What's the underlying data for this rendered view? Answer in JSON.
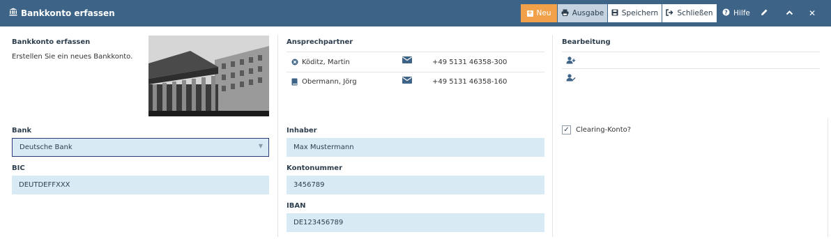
{
  "window": {
    "title": "Bankkonto erfassen",
    "title_icon": "bank-icon"
  },
  "toolbar": {
    "neu": "Neu",
    "ausgabe": "Ausgabe",
    "speichern": "Speichern",
    "schliessen": "Schließen",
    "hilfe": "Hilfe"
  },
  "intro": {
    "heading": "Bankkonto erfassen",
    "text": "Erstellen Sie ein neues Bankkonto."
  },
  "contacts": {
    "heading": "Ansprechpartner",
    "items": [
      {
        "name": "Köditz, Martin",
        "phone": "+49 5131 46358-300",
        "icon": "close-circle-icon"
      },
      {
        "name": "Obermann, Jörg",
        "phone": "+49 5131 46358-160",
        "icon": "book-icon"
      }
    ]
  },
  "editing": {
    "heading": "Bearbeitung"
  },
  "form": {
    "bank": {
      "label": "Bank",
      "value": "Deutsche Bank"
    },
    "bic": {
      "label": "BIC",
      "value": "DEUTDEFFXXX"
    },
    "inhaber": {
      "label": "Inhaber",
      "value": "Max Mustermann"
    },
    "kontonummer": {
      "label": "Kontonummer",
      "value": "3456789"
    },
    "iban": {
      "label": "IBAN",
      "value": "DE123456789"
    },
    "clearing": {
      "label": "Clearing-Konto?",
      "checked": true
    }
  },
  "colors": {
    "header": "#3d6387",
    "accent": "#f0a14a",
    "field": "#d8eaf4"
  }
}
